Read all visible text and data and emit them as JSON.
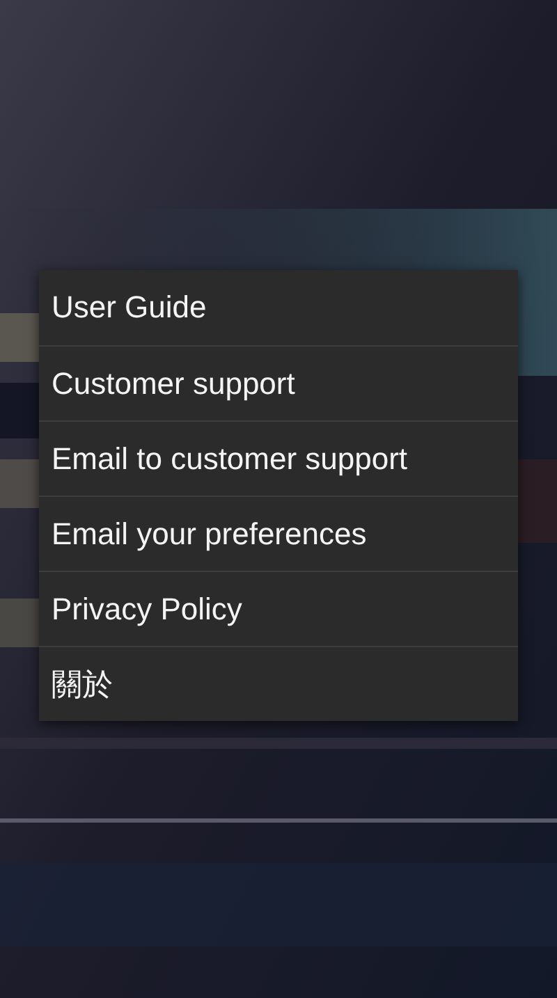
{
  "menu": {
    "items": [
      {
        "label": "User Guide"
      },
      {
        "label": "Customer support"
      },
      {
        "label": "Email to customer support"
      },
      {
        "label": "Email your preferences"
      },
      {
        "label": "Privacy Policy"
      },
      {
        "label": "關於"
      }
    ]
  }
}
